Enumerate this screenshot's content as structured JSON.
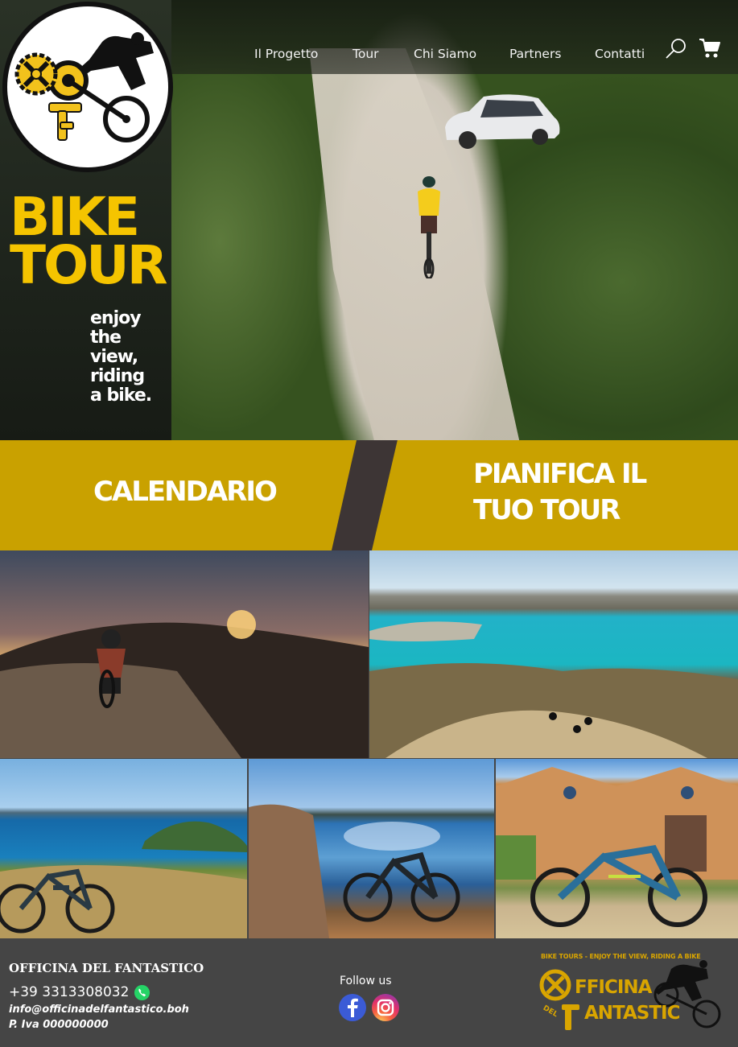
{
  "nav": {
    "items": [
      {
        "label": "Il Progetto"
      },
      {
        "label": "Tour"
      },
      {
        "label": "Chi Siamo"
      },
      {
        "label": "Partners"
      },
      {
        "label": "Contatti"
      }
    ],
    "search_icon": "search-icon",
    "cart_icon": "cart-icon"
  },
  "hero": {
    "title_line1": "BIKE",
    "title_line2": "TOUR",
    "tagline": [
      "enjoy",
      "the",
      "view,",
      "riding",
      "a bike."
    ]
  },
  "cta": {
    "left_label": "CALENDARIO",
    "right_label_line1": "PIANIFICA IL",
    "right_label_line2": "TUO TOUR"
  },
  "footer": {
    "company": "OFFICINA DEL FANTASTICO",
    "phone": "+39 3313308032",
    "email": "info@officinadelfantastico.boh",
    "vat": "P. Iva 000000000",
    "follow_label": "Follow us",
    "logo_tagline": "BIKE TOURS - ENJOY THE VIEW, RIDING A BIKE",
    "logo_word1": "FFICINA",
    "logo_word2": "ANTASTIC",
    "logo_del": "DEL"
  },
  "colors": {
    "accent": "#c9a100",
    "title_yellow": "#f5c400",
    "footer_bg": "#454545",
    "divider": "#3d3535",
    "whatsapp": "#25d366"
  }
}
